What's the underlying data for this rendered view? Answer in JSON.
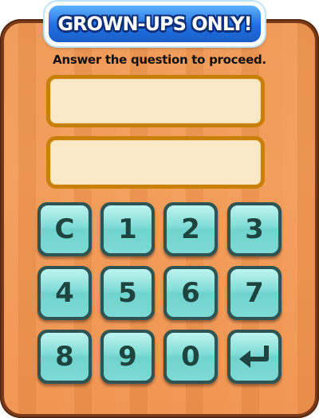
{
  "banner": {
    "title": "GROWN-UPS ONLY!"
  },
  "prompt": "Answer the question to proceed.",
  "fields": {
    "question": "",
    "answer": ""
  },
  "keypad": {
    "keys": [
      "C",
      "1",
      "2",
      "3",
      "4",
      "5",
      "6",
      "7",
      "8",
      "9",
      "0"
    ],
    "enter_icon": "enter-arrow-icon"
  },
  "colors": {
    "board_wood": "#f39a55",
    "board_frame": "#7a3a1a",
    "banner_blue": "#1f6fe0",
    "field_fill": "#f9e9c6",
    "field_border": "#c88008",
    "key_face": "#7fdcd6",
    "key_text": "#1e4440"
  }
}
